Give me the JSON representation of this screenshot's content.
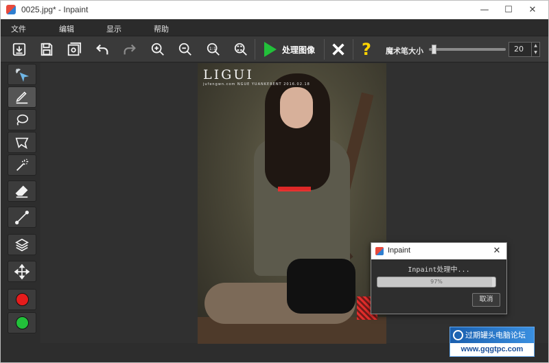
{
  "window": {
    "title": "0025.jpg* - Inpaint",
    "minimize_icon": "minimize-icon",
    "maximize_icon": "maximize-icon",
    "close_icon": "close-icon"
  },
  "menu": [
    "文件",
    "编辑",
    "显示",
    "帮助"
  ],
  "toolbar": {
    "buttons": [
      "import-icon",
      "save-icon",
      "save-preview-icon",
      "undo-icon",
      "redo-icon",
      "zoom-in-icon",
      "zoom-out-icon",
      "zoom-actual-icon",
      "zoom-fit-icon"
    ],
    "process_label": "处理图像",
    "clear_icon": "clear-x-icon",
    "help_icon": "help-question-icon",
    "brush_size_label": "魔术笔大小",
    "brush_size_value": "20",
    "brush_size_fraction": 0.04
  },
  "sidebar": {
    "tools": [
      "magic-select-icon",
      "marker-pen-icon",
      "lasso-icon",
      "polygon-lasso-icon",
      "magic-wand-icon",
      "eraser-icon",
      "line-tool-icon",
      "layers-icon",
      "move-icon"
    ],
    "colors": {
      "red": "#e51c1c",
      "green": "#22c03a"
    }
  },
  "photo": {
    "logo": "LIGUI",
    "logo_sub": "jufengwn.com  NGUE YUANKERENT  2016.02.18"
  },
  "dialog": {
    "title": "Inpaint",
    "message": "Inpaint处理中...",
    "progress_text": "97%",
    "progress_fraction": 0.97,
    "cancel_label": "取消"
  },
  "watermark": {
    "top_text": "过期罐头电脑论坛",
    "bottom_text": "www.gqgtpc.com"
  },
  "colors": {
    "accent_green": "#22c03a",
    "help_yellow": "#ffd400",
    "mask_red": "#ff2b2b"
  }
}
